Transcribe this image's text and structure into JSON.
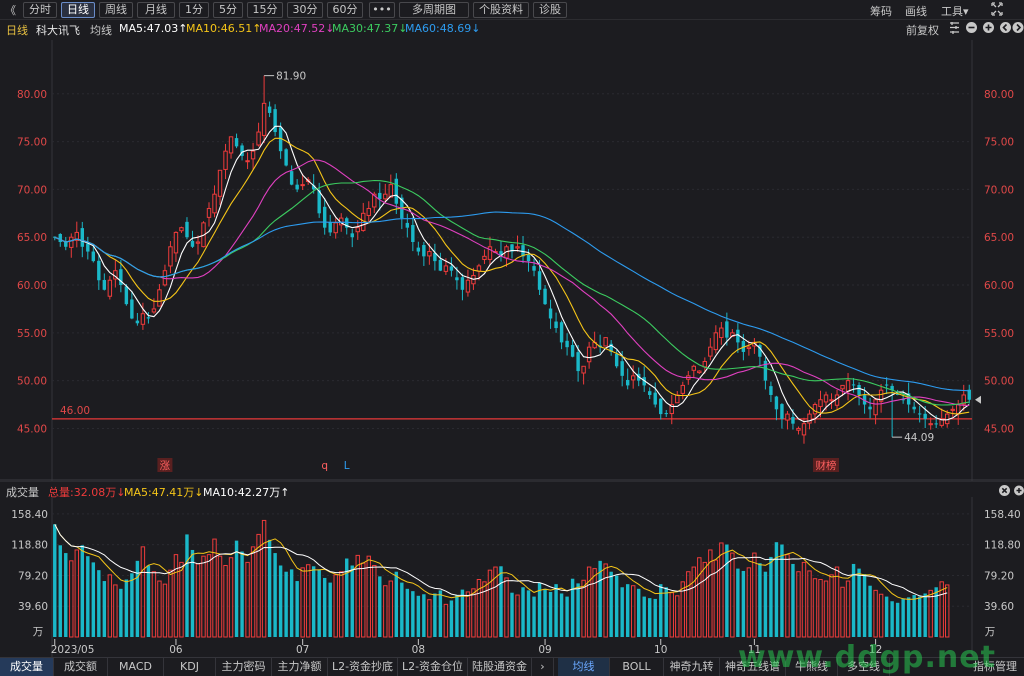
{
  "top_tabs": {
    "back": "《",
    "items": [
      "分时",
      "日线",
      "周线",
      "月线",
      "1分",
      "5分",
      "15分",
      "30分",
      "60分",
      "•••",
      "多周期图",
      "个股资料",
      "诊股"
    ],
    "active": "日线",
    "right": [
      "筹码",
      "画线",
      "工具▾"
    ]
  },
  "legend": {
    "period": "日线",
    "stock_name": "科大讯飞",
    "ma_label": "均线",
    "ma5": "MA5:47.03↑",
    "ma10": "MA10:46.51↑",
    "ma20": "MA20:47.52↓",
    "ma30": "MA30:47.37↓",
    "ma60": "MA60:48.69↓",
    "restore": "前复权"
  },
  "colors": {
    "up": "#ee3b3b",
    "down": "#1ab8c8",
    "ma5": "#ffffff",
    "ma10": "#f5c518",
    "ma20": "#e040c0",
    "ma30": "#3ccc60",
    "ma60": "#2d9cf0",
    "support_line": "#e83838",
    "axis_label": "#e04848",
    "grid": "#2a2a30"
  },
  "chart_data": [
    {
      "type": "candlestick",
      "ylim": [
        44,
        85
      ],
      "y_ticks": [
        "80.00",
        "75.00",
        "70.00",
        "65.00",
        "60.00",
        "55.00",
        "50.00",
        "45.00"
      ],
      "y_tick_values": [
        80,
        75,
        70,
        65,
        60,
        55,
        50,
        45
      ],
      "high_annotation": "81.90",
      "high_value": 81.9,
      "high_index": 38,
      "low_annotation": "44.09",
      "low_value": 44.09,
      "low_index": 152,
      "support_label": "46.00",
      "support_value": 46.0,
      "markers": [
        {
          "label": "涨",
          "index": 20
        },
        {
          "label": "q",
          "index": 49
        },
        {
          "label": "L",
          "index": 53
        },
        {
          "label": "财榜",
          "index": 140
        }
      ],
      "close": [
        65,
        64.5,
        64,
        65,
        65.5,
        64,
        63.5,
        62.5,
        60.5,
        59.5,
        60.5,
        61.5,
        60,
        58,
        56.5,
        56,
        57,
        56.5,
        57.5,
        59.5,
        61.5,
        64,
        65.5,
        66,
        65,
        64,
        64.5,
        66.5,
        68,
        69.5,
        72,
        74,
        75.5,
        74.5,
        73.5,
        73,
        74,
        76,
        79,
        78,
        76,
        74,
        72.5,
        70.5,
        70,
        70.5,
        71,
        70,
        67.5,
        66,
        65.5,
        66.5,
        67,
        66,
        65,
        66,
        67.5,
        68,
        69.5,
        69,
        69.5,
        70.5,
        68.5,
        67,
        66,
        64.5,
        63.5,
        63,
        63.5,
        62.5,
        61.5,
        62,
        61.5,
        60.5,
        59.5,
        60.5,
        61,
        62,
        63,
        64,
        63.5,
        63,
        64,
        63.5,
        64,
        63,
        62.5,
        61.5,
        59.5,
        58,
        56.5,
        55.5,
        54,
        53.5,
        52.5,
        51,
        51.5,
        53.5,
        54,
        53.5,
        54.5,
        53,
        51.5,
        50.5,
        49.5,
        50.5,
        50,
        49.5,
        48.5,
        47.5,
        46.5,
        46.5,
        47.5,
        48.5,
        49.5,
        50.5,
        51.5,
        51,
        52,
        53.5,
        55,
        55.5,
        54.5,
        55,
        54,
        53,
        53.5,
        54,
        52.5,
        50,
        48.5,
        47,
        46,
        46.5,
        45.5,
        45,
        45.5,
        46.5,
        47.5,
        48,
        48.5,
        48,
        48.5,
        49.5,
        50,
        49.5,
        48.5,
        47.5,
        47,
        48,
        49,
        49.5,
        49,
        48.5,
        48,
        47.5,
        47,
        46.5,
        46,
        45.5,
        45.5,
        46,
        46.5,
        47,
        47.5,
        48.5,
        48
      ],
      "x_labels": [
        {
          "label": "2023/05",
          "index": 0
        },
        {
          "label": "06",
          "index": 22
        },
        {
          "label": "07",
          "index": 45
        },
        {
          "label": "08",
          "index": 66
        },
        {
          "label": "09",
          "index": 89
        },
        {
          "label": "10",
          "index": 110
        },
        {
          "label": "11",
          "index": 127
        },
        {
          "label": "12",
          "index": 149
        }
      ]
    },
    {
      "type": "bar",
      "name": "成交量",
      "ylim": [
        0,
        175
      ],
      "y_ticks": [
        "158.40",
        "118.80",
        "79.20",
        "39.60",
        "万"
      ],
      "y_tick_values": [
        158.4,
        118.8,
        79.2,
        39.6
      ],
      "unit": "万",
      "values": [
        145,
        118,
        108,
        98,
        112,
        118,
        104,
        96,
        86,
        72,
        80,
        67,
        62,
        74,
        82,
        98,
        116,
        92,
        84,
        72,
        68,
        86,
        106,
        96,
        132,
        112,
        94,
        104,
        106,
        126,
        104,
        92,
        102,
        124,
        110,
        96,
        116,
        132,
        150,
        125,
        108,
        92,
        84,
        87,
        72,
        89,
        93,
        91,
        87,
        76,
        70,
        80,
        84,
        101,
        92,
        105,
        95,
        104,
        92,
        78,
        66,
        72,
        84,
        70,
        62,
        59,
        53,
        55,
        48,
        56,
        60,
        42,
        47,
        54,
        61,
        58,
        62,
        74,
        71,
        86,
        90,
        91,
        76,
        57,
        54,
        64,
        60,
        52,
        70,
        62,
        58,
        68,
        56,
        52,
        75,
        69,
        73,
        90,
        88,
        98,
        94,
        84,
        79,
        64,
        68,
        66,
        62,
        52,
        50,
        49,
        68,
        64,
        57,
        53,
        71,
        84,
        90,
        102,
        96,
        112,
        99,
        121,
        119,
        108,
        88,
        85,
        89,
        108,
        95,
        84,
        103,
        122,
        119,
        106,
        94,
        84,
        96,
        85,
        75,
        74,
        72,
        80,
        90,
        64,
        72,
        94,
        88,
        81,
        66,
        60,
        55,
        52,
        46,
        44,
        49,
        51,
        54,
        52,
        56,
        60,
        64,
        71,
        67
      ],
      "volume_total": "总量:32.08万↓",
      "ma5": "MA5:47.41万↓",
      "ma10": "MA10:42.27万↑",
      "title": "成交量"
    }
  ],
  "bottom_tabs": {
    "left": [
      "成交量",
      "成交额",
      "MACD",
      "KDJ",
      "主力密码",
      "主力净额",
      "L2-资金抄底",
      "L2-资金仓位",
      "陆股通资金"
    ],
    "arrow": "›",
    "right": [
      "均线",
      "BOLL",
      "神奇九转",
      "神奇五线谱",
      "牛熊线",
      "多空线"
    ],
    "settings": "指标管理"
  },
  "watermark": "www.ddgp.net"
}
